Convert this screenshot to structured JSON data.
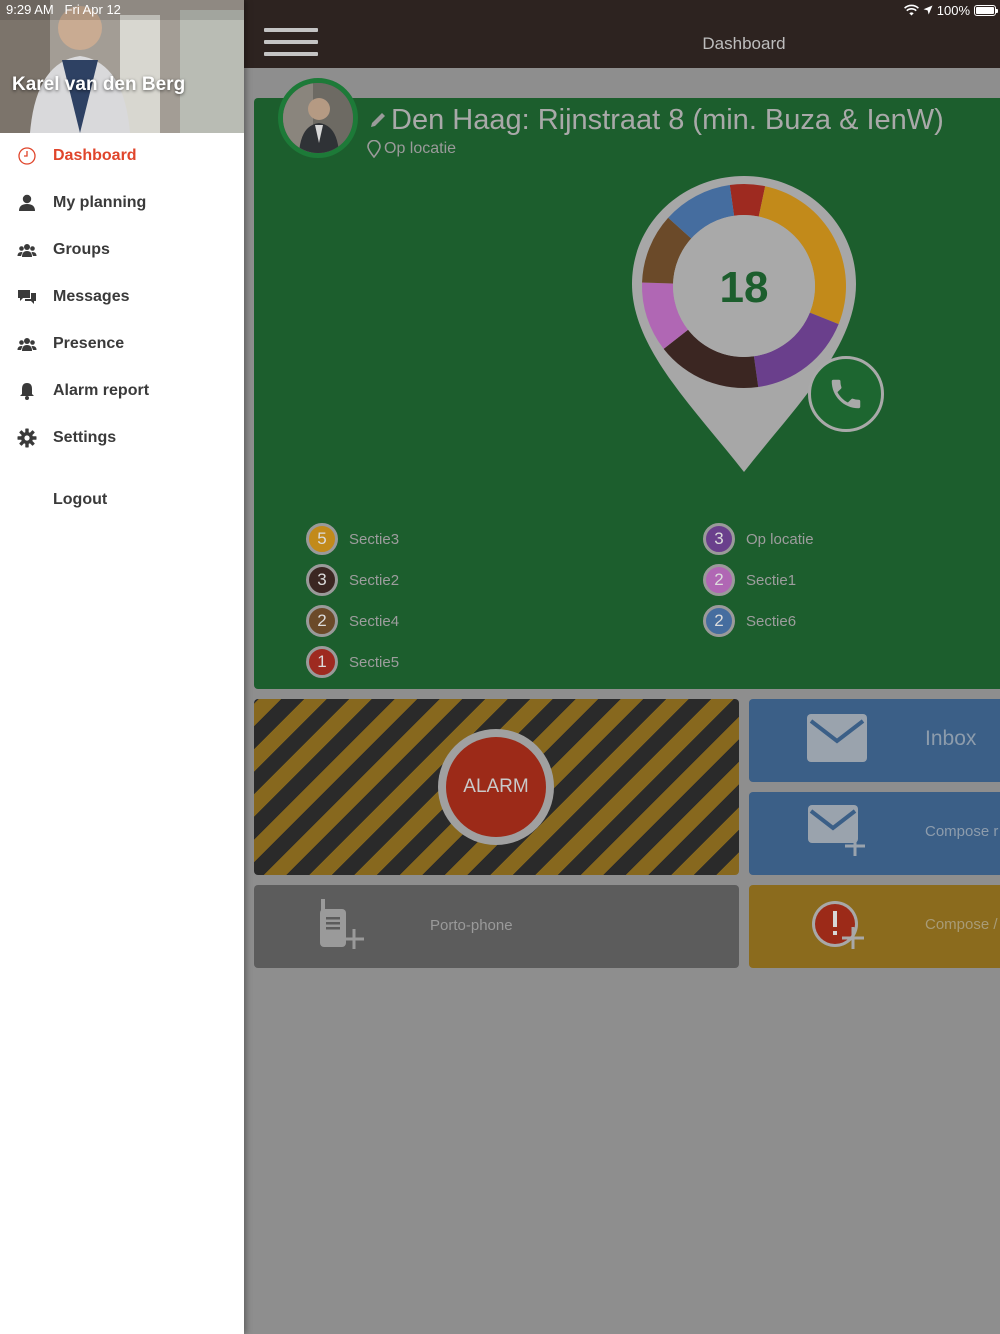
{
  "status_bar": {
    "time": "9:29 AM",
    "date": "Fri Apr 12",
    "battery": "100%"
  },
  "header": {
    "title": "Dashboard"
  },
  "drawer": {
    "user_name": "Karel van den Berg",
    "items": [
      {
        "label": "Dashboard",
        "icon": "clock-icon",
        "active": true
      },
      {
        "label": "My planning",
        "icon": "person-icon"
      },
      {
        "label": "Groups",
        "icon": "group-icon"
      },
      {
        "label": "Messages",
        "icon": "chat-icon"
      },
      {
        "label": "Presence",
        "icon": "group-icon"
      },
      {
        "label": "Alarm report",
        "icon": "bell-icon"
      },
      {
        "label": "Settings",
        "icon": "gear-icon"
      }
    ],
    "logout_label": "Logout"
  },
  "location": {
    "title": "Den Haag: Rijnstraat 8 (min. Buza & IenW)",
    "status": "Op locatie",
    "total": "18",
    "segments": [
      {
        "name": "Sectie3",
        "count": 5,
        "color": "#c28a1a"
      },
      {
        "name": "Op locatie",
        "count": 3,
        "color": "#6a3f8c"
      },
      {
        "name": "Sectie2",
        "count": 3,
        "color": "#3b2622"
      },
      {
        "name": "Sectie1",
        "count": 2,
        "color": "#b067b4"
      },
      {
        "name": "Sectie4",
        "count": 2,
        "color": "#6b4a29"
      },
      {
        "name": "Sectie6",
        "count": 2,
        "color": "#456d9f"
      },
      {
        "name": "Sectie5",
        "count": 1,
        "color": "#9e2a20"
      }
    ]
  },
  "tiles": {
    "alarm_label": "ALARM",
    "inbox_label": "Inbox",
    "compose_label": "Compose r",
    "porto_label": "Porto-phone",
    "alarm_compose_label": "Compose /"
  },
  "colors": {
    "accent": "#e0452b",
    "card_green": "#1c5e2d",
    "topbar": "#2d2320"
  }
}
